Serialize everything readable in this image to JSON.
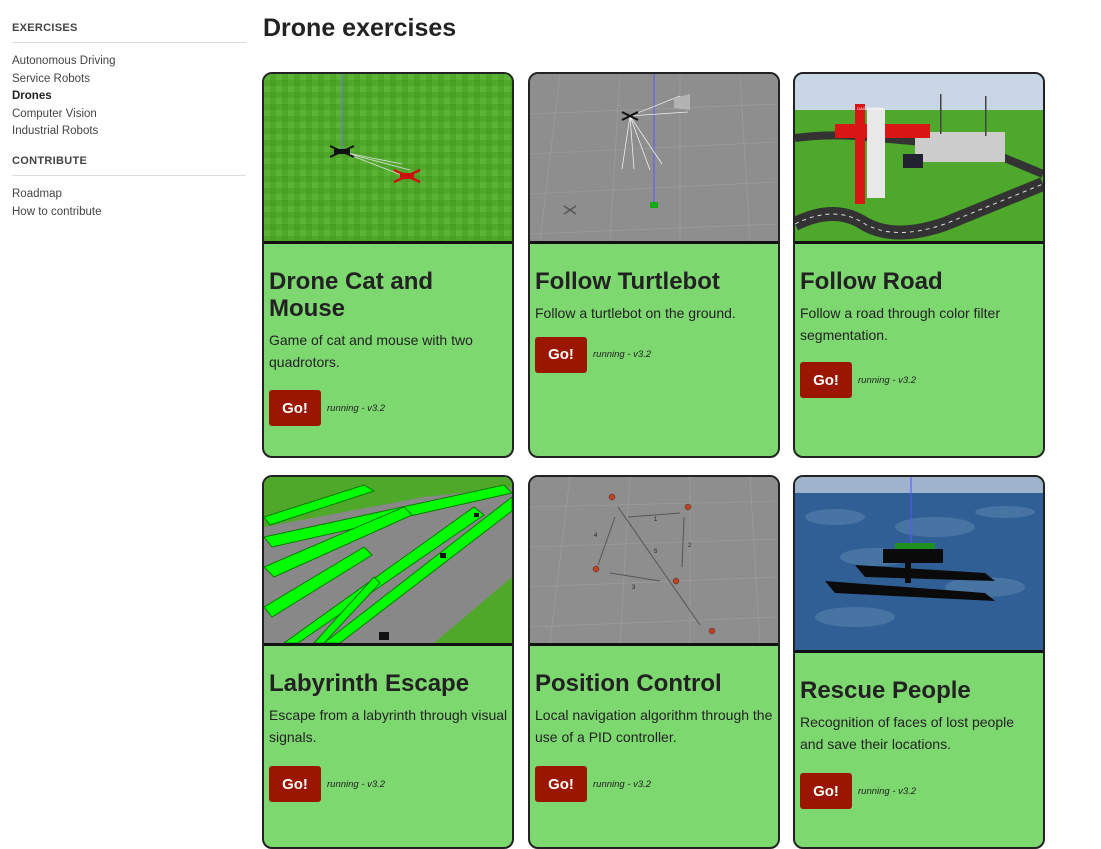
{
  "sidebar": {
    "sections": [
      {
        "heading": "EXERCISES",
        "items": [
          "Autonomous Driving",
          "Service Robots",
          "Drones",
          "Computer Vision",
          "Industrial Robots"
        ]
      },
      {
        "heading": "CONTRIBUTE",
        "items": [
          "Roadmap",
          "How to contribute"
        ]
      }
    ],
    "active_item": "Drones"
  },
  "page": {
    "title": "Drone exercises"
  },
  "cards": [
    {
      "title": "Drone Cat and Mouse",
      "description": "Game of cat and mouse with two quadrotors.",
      "button": "Go!",
      "status": "running - v3.2",
      "thumbnail": "drone-cat-mouse-scene"
    },
    {
      "title": "Follow Turtlebot",
      "description": "Follow a turtlebot on the ground.",
      "button": "Go!",
      "status": "running - v3.2",
      "thumbnail": "follow-turtlebot-scene"
    },
    {
      "title": "Follow Road",
      "description": "Follow a road through color filter segmentation.",
      "button": "Go!",
      "status": "running - v3.2",
      "thumbnail": "follow-road-scene"
    },
    {
      "title": "Labyrinth Escape",
      "description": "Escape from a labyrinth through visual signals.",
      "button": "Go!",
      "status": "running - v3.2",
      "thumbnail": "labyrinth-scene"
    },
    {
      "title": "Position Control",
      "description": "Local navigation algorithm through the use of a PID controller.",
      "button": "Go!",
      "status": "running - v3.2",
      "thumbnail": "position-control-scene"
    },
    {
      "title": "Rescue People",
      "description": "Recognition of faces of lost people and save their locations.",
      "button": "Go!",
      "status": "running - v3.2",
      "thumbnail": "rescue-people-scene"
    }
  ],
  "scene_labels": {
    "gas_station": "GAS STATION",
    "waypoints": [
      "1",
      "2",
      "3",
      "4",
      "5"
    ]
  },
  "colors": {
    "card_bg": "#7ed870",
    "button_bg": "#9a1600",
    "card_border": "#222222"
  }
}
